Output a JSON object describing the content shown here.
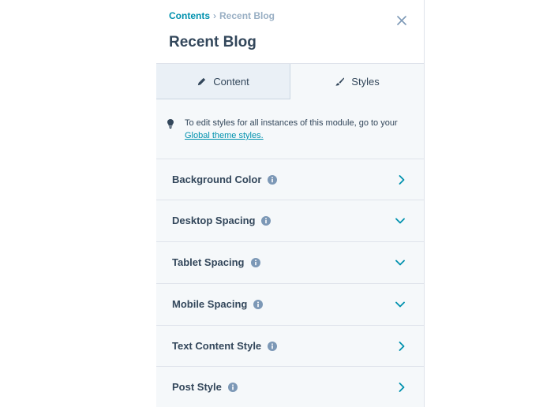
{
  "breadcrumb": {
    "parent": "Contents",
    "separator": "›",
    "current": "Recent Blog"
  },
  "header": {
    "title": "Recent Blog"
  },
  "tabs": [
    {
      "label": "Content",
      "icon": "pencil-icon",
      "active": false
    },
    {
      "label": "Styles",
      "icon": "brush-icon",
      "active": true
    }
  ],
  "notice": {
    "text": "To edit styles for all instances of this module, go to your ",
    "link": "Global theme styles."
  },
  "sections": [
    {
      "label": "Background Color",
      "state": "collapsed"
    },
    {
      "label": "Desktop Spacing",
      "state": "expanded"
    },
    {
      "label": "Tablet Spacing",
      "state": "expanded"
    },
    {
      "label": "Mobile Spacing",
      "state": "expanded"
    },
    {
      "label": "Text Content Style",
      "state": "collapsed"
    },
    {
      "label": "Post Style",
      "state": "collapsed"
    }
  ],
  "colors": {
    "accent": "#0091ae",
    "text": "#33475b",
    "panel_bg": "#f5f8fa",
    "tab_inactive_bg": "#eaf0f6",
    "border": "#dfe3eb"
  }
}
